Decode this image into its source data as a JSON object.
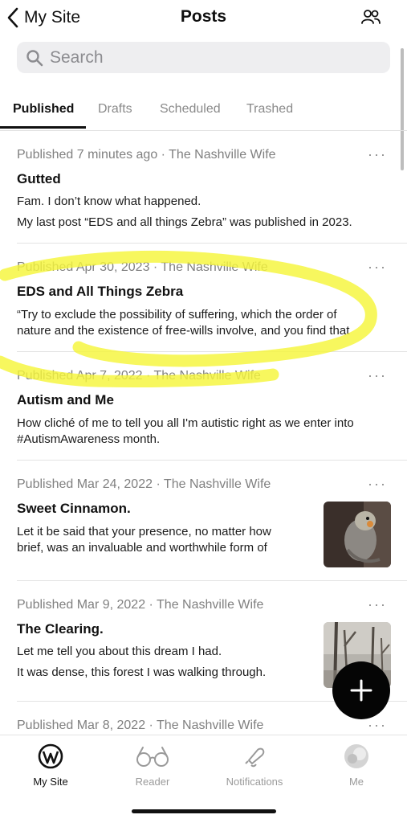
{
  "nav": {
    "back_label": "My Site",
    "title": "Posts"
  },
  "search": {
    "placeholder": "Search"
  },
  "tabs": [
    {
      "label": "Published",
      "active": true
    },
    {
      "label": "Drafts",
      "active": false
    },
    {
      "label": "Scheduled",
      "active": false
    },
    {
      "label": "Trashed",
      "active": false
    }
  ],
  "more_glyph": "···",
  "posts": [
    {
      "meta": "Published 7 minutes ago · The Nashville Wife",
      "title": "Gutted",
      "excerpt": [
        "Fam. I don’t know what happened.",
        "My last post “EDS and all things Zebra” was published in 2023."
      ]
    },
    {
      "meta": "Published Apr 30, 2023 · The Nashville Wife",
      "title": "EDS and All Things Zebra",
      "excerpt": [
        "“Try to exclude the possibility of suffering, which the order of",
        "nature and the existence of free-wills involve, and you find that"
      ]
    },
    {
      "meta": "Published Apr 7, 2022 · The Nashville Wife",
      "title": "Autism and Me",
      "excerpt": [
        "How cliché of me to tell you all I'm autistic right as we enter into",
        "#AutismAwareness month."
      ]
    },
    {
      "meta": "Published Mar 24, 2022 · The Nashville Wife",
      "title": "Sweet Cinnamon.",
      "excerpt": [
        "Let it be said that your presence, no matter how",
        "brief, was an invaluable and worthwhile form of"
      ]
    },
    {
      "meta": "Published Mar 9, 2022 · The Nashville Wife",
      "title": "The Clearing.",
      "excerpt": [
        "Let me tell you about this dream I had.",
        "It was dense, this forest I was walking through."
      ]
    },
    {
      "meta": "Published Mar 8, 2022 · The Nashville Wife"
    }
  ],
  "bottom_nav": [
    {
      "label": "My Site",
      "icon": "wordpress-icon",
      "active": true
    },
    {
      "label": "Reader",
      "icon": "glasses-icon",
      "active": false
    },
    {
      "label": "Notifications",
      "icon": "bell-icon",
      "active": false
    },
    {
      "label": "Me",
      "icon": "avatar-icon",
      "active": false
    }
  ],
  "colors": {
    "highlight": "#f5f53a",
    "fab": "#050505",
    "text": "#111111",
    "muted": "#808080"
  }
}
